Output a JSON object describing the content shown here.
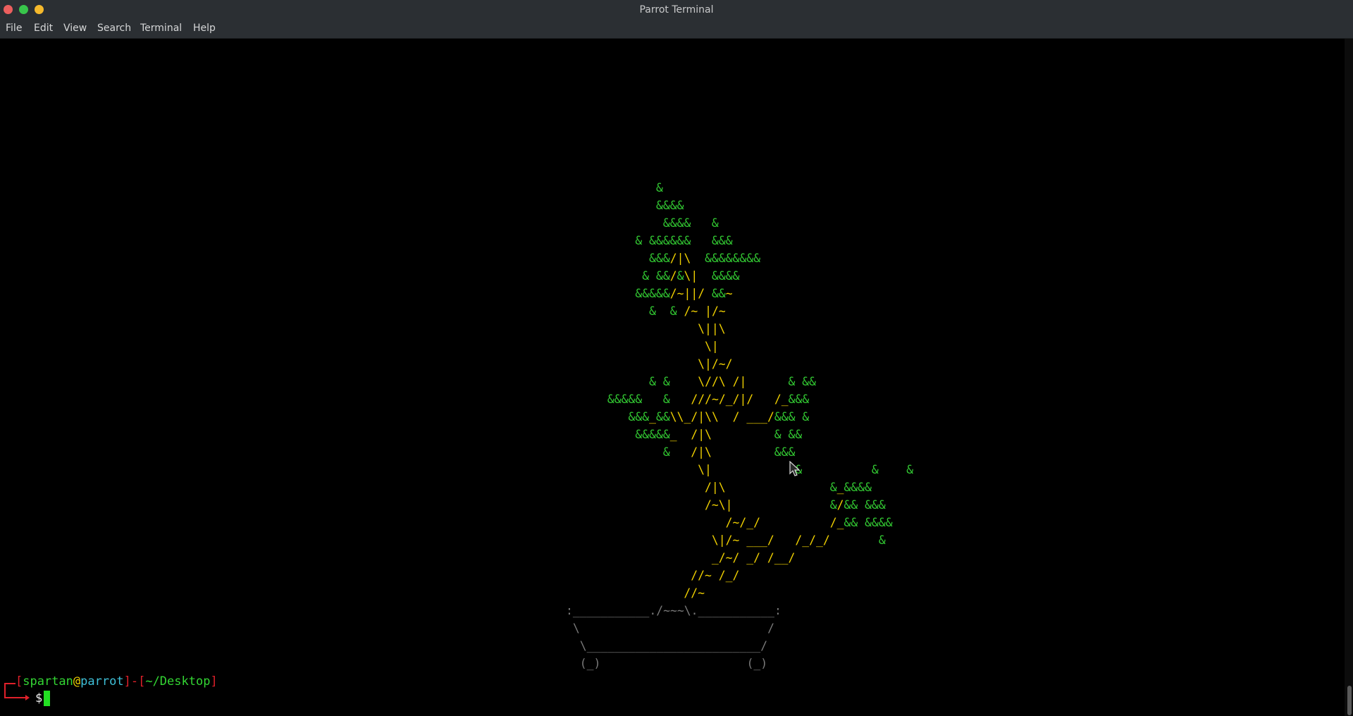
{
  "window": {
    "title": "Parrot Terminal"
  },
  "menubar": {
    "items": [
      "File",
      "Edit",
      "View",
      "Search",
      "Terminal",
      "Help"
    ]
  },
  "terminal": {
    "bonsai_art": [
      "        &",
      "        &&&&",
      "         &&&&   &",
      "     & &&&&&&   &&&",
      "       &&&/|\\  &&&&&&&&",
      "      & &&/&\\|  &&&&",
      "     &&&&&/~||/ &&~",
      "       &  & /~ |/~",
      "              \\||\\",
      "               \\|",
      "              \\|/~/",
      "       & &    \\//\\ /|      & &&",
      " &&&&&   &   ///~/_/|/   /_&&&",
      "    &&&_&&\\\\_/|\\\\  / ___/&&& &",
      "     &&&&&_  /|\\         & &&",
      "         &   /|\\         &&&",
      "              \\|            &          &    &",
      "               /|\\               &_&&&&",
      "               /~\\|              &/&& &&&",
      "                  /~/_/          /_&& &&&&",
      "                \\|/~ ___/   /_/_/       &",
      "                _/~/ _/ /__/",
      "             //~ /_/",
      "            //~"
    ],
    "pot_art": [
      ":___________./~~~\\.___________:",
      " \\                           /",
      "  \\_________________________/",
      "  (_)                     (_)"
    ],
    "prompt": {
      "open_bracket": "[",
      "user": "spartan",
      "at": "@",
      "host": "parrot",
      "close_bracket": "]",
      "dash": "-",
      "path_open": "[",
      "path": "~/Desktop",
      "path_close": "]",
      "symbol": "$"
    }
  },
  "colors": {
    "leaf": "#32c832",
    "trunk": "#f0d000",
    "pot": "#7a7a7a",
    "prompt_bracket": "#e0202a",
    "prompt_user": "#33d633",
    "prompt_host": "#3fc0d8"
  }
}
